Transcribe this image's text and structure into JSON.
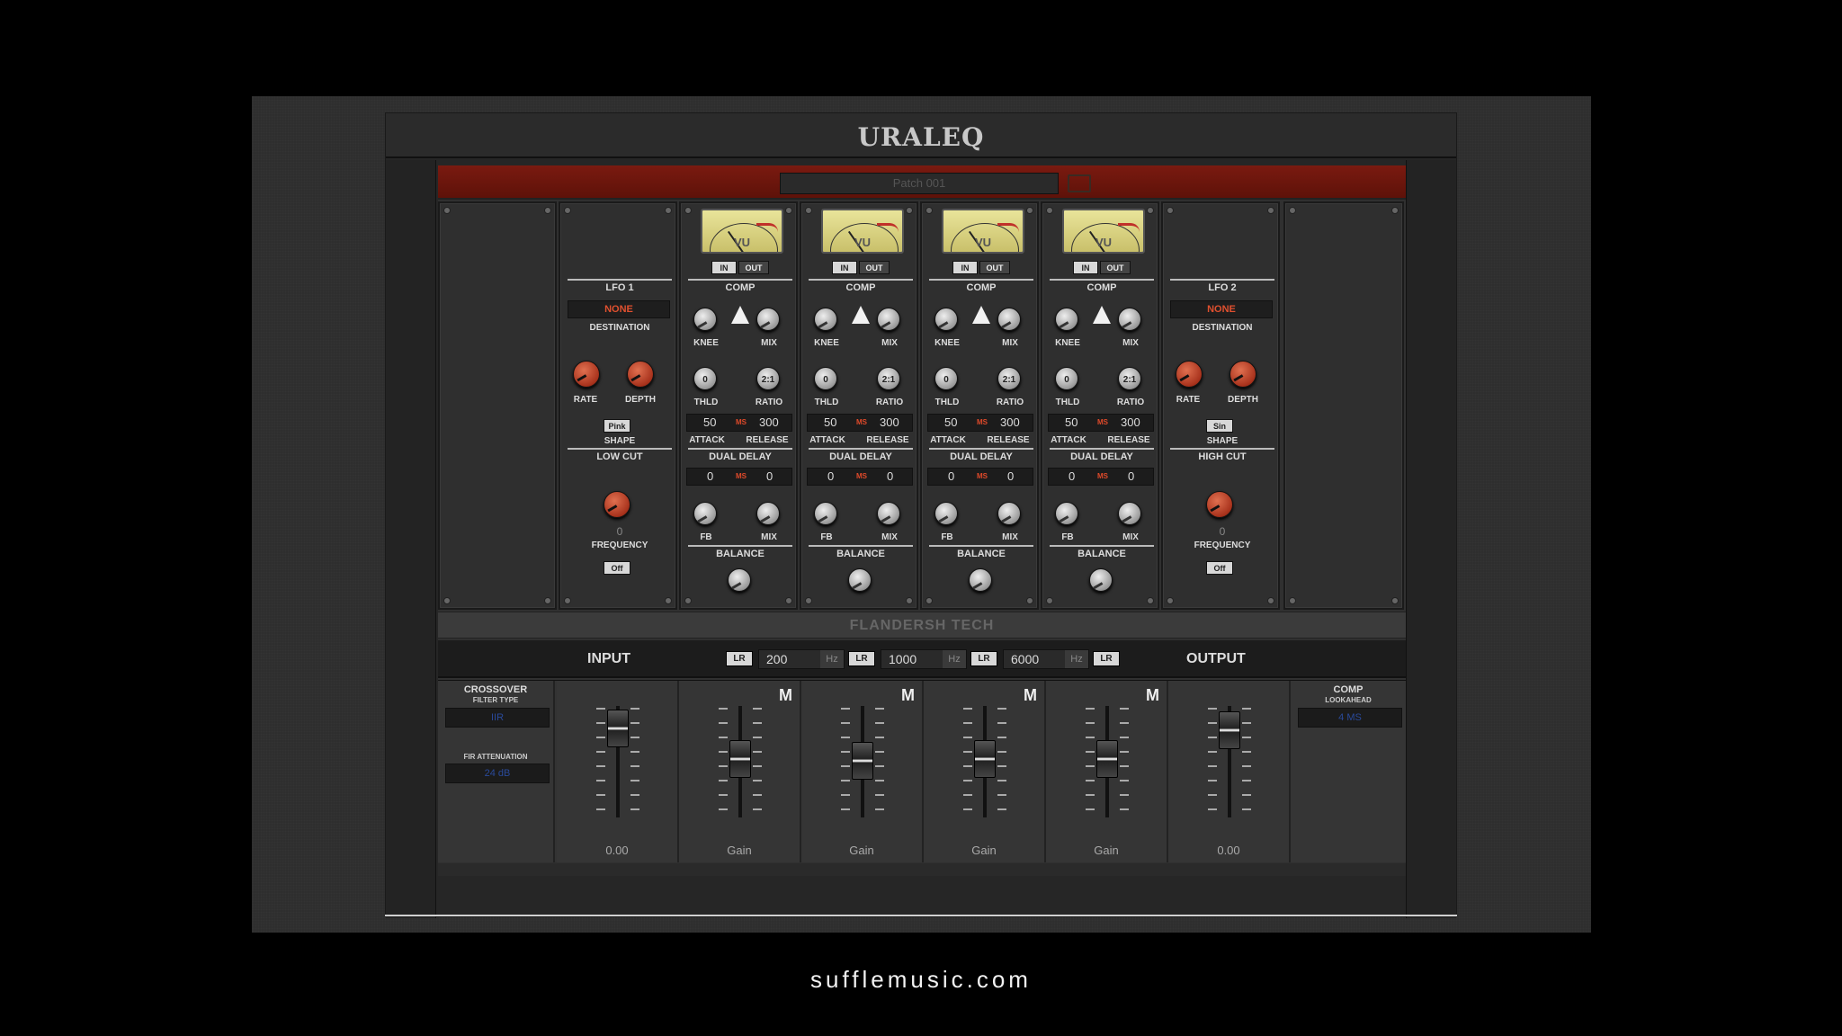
{
  "app": {
    "logo": "URALEQ",
    "patch_name": "Patch 001",
    "brand_banner": "FLANDERSH TECH"
  },
  "lfo1": {
    "title": "LFO 1",
    "destination": "NONE",
    "destination_label": "DESTINATION",
    "rate_label": "RATE",
    "depth_label": "DEPTH",
    "shape": "Pink",
    "shape_label": "SHAPE",
    "filter_title": "LOW CUT",
    "frequency_value": "0",
    "frequency_label": "FREQUENCY",
    "toggle": "Off"
  },
  "lfo2": {
    "title": "LFO 2",
    "destination": "NONE",
    "destination_label": "DESTINATION",
    "rate_label": "RATE",
    "depth_label": "DEPTH",
    "shape": "Sin",
    "shape_label": "SHAPE",
    "filter_title": "HIGH CUT",
    "frequency_value": "0",
    "frequency_label": "FREQUENCY",
    "toggle": "Off"
  },
  "comps": [
    {
      "vu": "VU",
      "in": "IN",
      "out": "OUT",
      "title": "COMP",
      "knee": "KNEE",
      "mix": "MIX",
      "thld_val": "0",
      "ratio_val": "2:1",
      "thld": "THLD",
      "ratio": "RATIO",
      "attack_val": "50",
      "release_val": "300",
      "ms": "MS",
      "attack": "ATTACK",
      "release": "RELEASE",
      "delay_title": "DUAL DELAY",
      "delay_l": "0",
      "delay_r": "0",
      "fb": "FB",
      "dmix": "MIX",
      "balance": "BALANCE"
    },
    {
      "vu": "VU",
      "in": "IN",
      "out": "OUT",
      "title": "COMP",
      "knee": "KNEE",
      "mix": "MIX",
      "thld_val": "0",
      "ratio_val": "2:1",
      "thld": "THLD",
      "ratio": "RATIO",
      "attack_val": "50",
      "release_val": "300",
      "ms": "MS",
      "attack": "ATTACK",
      "release": "RELEASE",
      "delay_title": "DUAL DELAY",
      "delay_l": "0",
      "delay_r": "0",
      "fb": "FB",
      "dmix": "MIX",
      "balance": "BALANCE"
    },
    {
      "vu": "VU",
      "in": "IN",
      "out": "OUT",
      "title": "COMP",
      "knee": "KNEE",
      "mix": "MIX",
      "thld_val": "0",
      "ratio_val": "2:1",
      "thld": "THLD",
      "ratio": "RATIO",
      "attack_val": "50",
      "release_val": "300",
      "ms": "MS",
      "attack": "ATTACK",
      "release": "RELEASE",
      "delay_title": "DUAL DELAY",
      "delay_l": "0",
      "delay_r": "0",
      "fb": "FB",
      "dmix": "MIX",
      "balance": "BALANCE"
    },
    {
      "vu": "VU",
      "in": "IN",
      "out": "OUT",
      "title": "COMP",
      "knee": "KNEE",
      "mix": "MIX",
      "thld_val": "0",
      "ratio_val": "2:1",
      "thld": "THLD",
      "ratio": "RATIO",
      "attack_val": "50",
      "release_val": "300",
      "ms": "MS",
      "attack": "ATTACK",
      "release": "RELEASE",
      "delay_title": "DUAL DELAY",
      "delay_l": "0",
      "delay_r": "0",
      "fb": "FB",
      "dmix": "MIX",
      "balance": "BALANCE"
    }
  ],
  "io": {
    "input": "INPUT",
    "output": "OUTPUT",
    "lr": "LR",
    "hz": "Hz",
    "crossovers": [
      "200",
      "1000",
      "6000"
    ]
  },
  "mixer": {
    "crossover_title": "CROSSOVER",
    "filter_type_label": "FILTER TYPE",
    "filter_type": "IIR",
    "fir_label": "FIR ATTENUATION",
    "fir_value": "24 dB",
    "comp_title": "COMP",
    "lookahead_label": "LOOKAHEAD",
    "lookahead": "4 MS",
    "mute": "M",
    "channels": [
      "0.00",
      "Gain",
      "Gain",
      "Gain",
      "Gain",
      "0.00"
    ]
  },
  "footer": {
    "site": "sufflemusic.com"
  }
}
